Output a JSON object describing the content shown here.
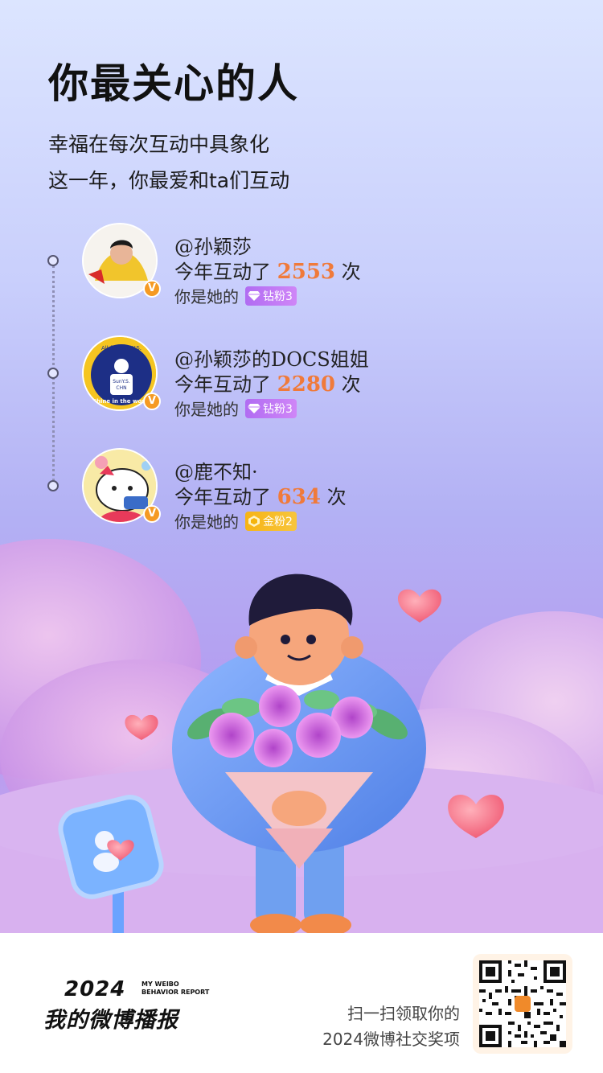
{
  "header": {
    "title": "你最关心的人",
    "subtitle_line1": "幸福在每次互动中具象化",
    "subtitle_line2": "这一年，你最爱和ta们互动"
  },
  "people": [
    {
      "name": "@孙颖莎",
      "count_prefix": "今年互动了",
      "count": "2553",
      "count_suffix": "次",
      "relation": "你是她的",
      "badge": "钻粉3",
      "badge_type": "diamond",
      "verified": "V"
    },
    {
      "name": "@孙颖莎的DOCS姐姐",
      "count_prefix": "今年互动了",
      "count": "2280",
      "count_suffix": "次",
      "relation": "你是她的",
      "badge": "钻粉3",
      "badge_type": "diamond",
      "verified": "V",
      "avatar_text_top": "All for Sun Y.S.",
      "avatar_text_mid": "SunY.S.",
      "avatar_text_mid2": "CHN",
      "avatar_text_bottom": "Shine in the world"
    },
    {
      "name": "@鹿不知·",
      "count_prefix": "今年互动了",
      "count": "634",
      "count_suffix": "次",
      "relation": "你是她的",
      "badge": "金粉2",
      "badge_type": "gold",
      "verified": "V"
    }
  ],
  "footer": {
    "brand_year": "2024",
    "brand_en": "MY WEIBO BEHAVIOR REPORT",
    "brand_cn": "我的微博播报",
    "scan_line1": "扫一扫领取你的",
    "scan_line2": "2024微博社交奖项"
  },
  "colors": {
    "accent_count": "#f07a3a",
    "diamond_badge": "#b16cf2",
    "gold_badge": "#f7b414",
    "verified": "#f59a23"
  },
  "icons": [
    "verified-v-icon",
    "diamond-gem-icon",
    "gold-gem-icon",
    "qr-code-icon",
    "heart-icon"
  ]
}
